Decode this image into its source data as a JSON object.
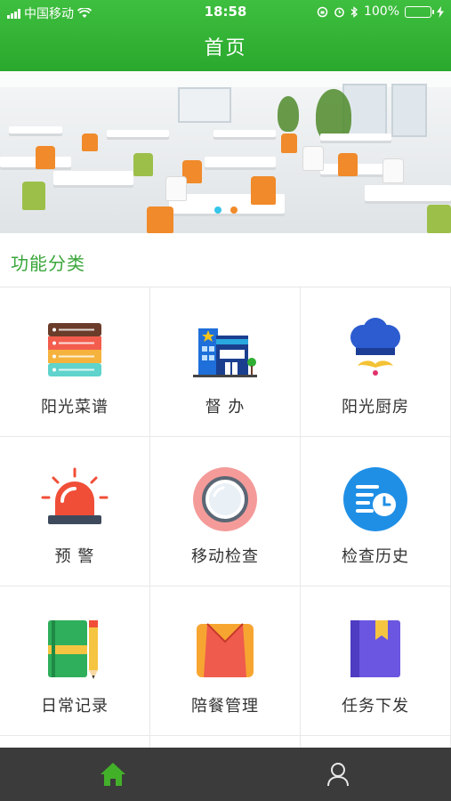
{
  "status_bar": {
    "carrier": "中国移动",
    "time": "18:58",
    "battery": "100%"
  },
  "nav": {
    "title": "首页"
  },
  "banner": {
    "page_count": 2,
    "active_index": 1
  },
  "section": {
    "title": "功能分类"
  },
  "features": [
    {
      "label": "阳光菜谱",
      "icon": "menu-list-icon"
    },
    {
      "label": "督 办",
      "icon": "shop-building-icon"
    },
    {
      "label": "阳光厨房",
      "icon": "chef-hat-icon"
    },
    {
      "label": "预 警",
      "icon": "alarm-siren-icon"
    },
    {
      "label": "移动检查",
      "icon": "mobile-check-icon"
    },
    {
      "label": "检查历史",
      "icon": "history-clock-icon"
    },
    {
      "label": "日常记录",
      "icon": "notebook-pencil-icon"
    },
    {
      "label": "陪餐管理",
      "icon": "meal-bag-icon"
    },
    {
      "label": "任务下发",
      "icon": "task-book-icon"
    }
  ],
  "tabs": [
    {
      "name": "home",
      "icon": "home-icon",
      "active": true
    },
    {
      "name": "profile",
      "icon": "user-icon",
      "active": false
    }
  ],
  "colors": {
    "brand_green": "#2fae33",
    "tab_bar": "#3b3b3b",
    "tab_active": "#43b02a"
  }
}
